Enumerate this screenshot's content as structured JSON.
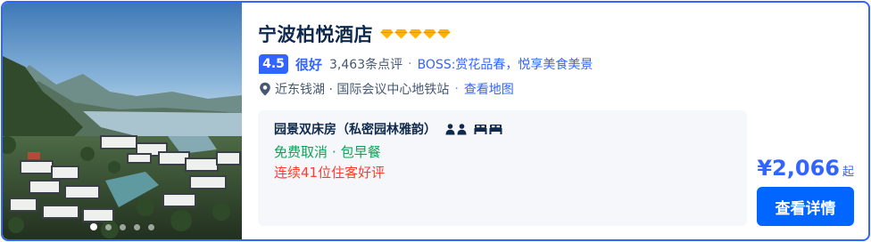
{
  "hotel": {
    "name": "宁波柏悦酒店",
    "diamond_count": 5,
    "diamond_color": "#ffb400",
    "score": "4.5",
    "rating_word": "很好",
    "review_count": "3,463条点评",
    "separator": "·",
    "tagline": "BOSS:赏花品春，悦享美食美景",
    "location": "近东钱湖 · 国际会议中心地铁站",
    "map_link": "查看地图"
  },
  "gallery": {
    "dot_count": 5,
    "active_dot": 1
  },
  "room": {
    "name": "园景双床房（私密园林雅韵）",
    "guest_icons": [
      "person-icon",
      "person-icon"
    ],
    "bed_icons": [
      "twin-bed-icon",
      "twin-bed-icon"
    ],
    "policy_cancel": "免费取消",
    "policy_dot": "·",
    "policy_breakfast": "包早餐",
    "promo": "连续41位住客好评"
  },
  "price": {
    "amount": "¥2,066",
    "suffix": "起"
  },
  "cta": {
    "label": "查看详情"
  },
  "colors": {
    "accent": "#3264ff",
    "button": "#0066ff",
    "promo": "#ff3c2d",
    "policy": "#0da357"
  }
}
